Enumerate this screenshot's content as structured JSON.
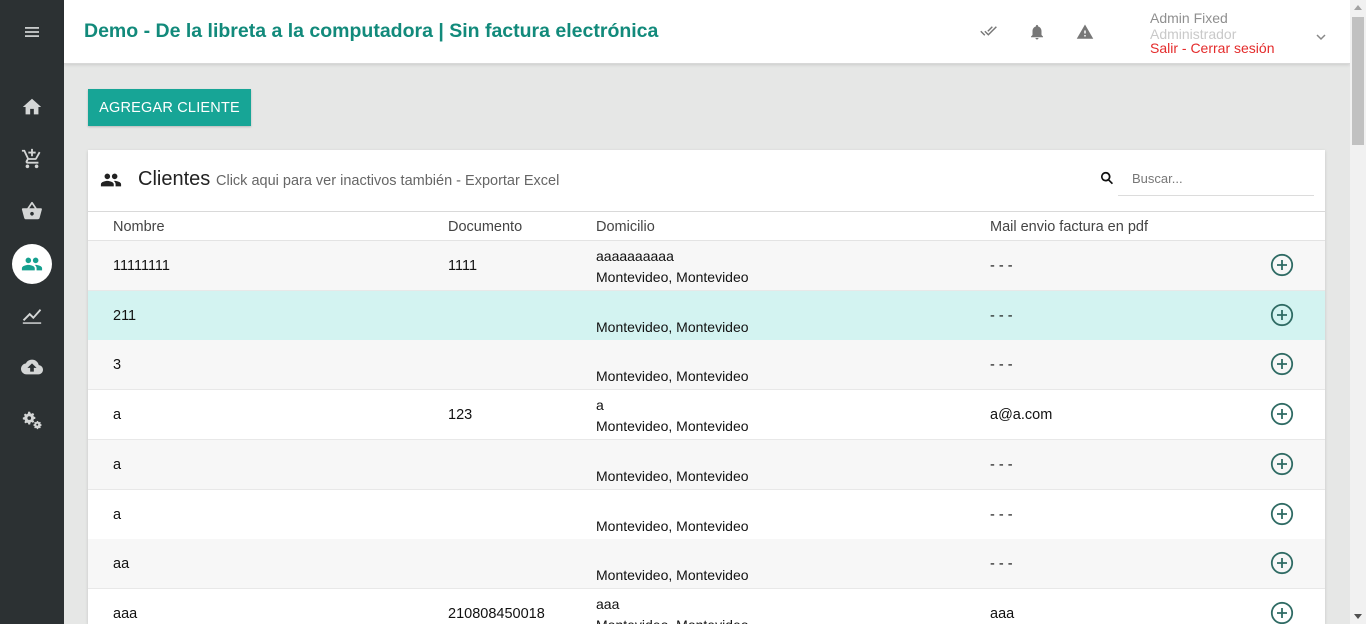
{
  "header": {
    "title": "Demo - De la libreta a la computadora | Sin factura electrónica",
    "user_name": "Admin Fixed",
    "user_role": "Administrador",
    "logout": "Salir - Cerrar sesión"
  },
  "sidebar": {
    "items": [
      "menu-icon",
      "home-icon",
      "cart-icon",
      "basket-icon",
      "clients-icon",
      "chart-icon",
      "upload-icon",
      "settings-icon"
    ],
    "active": "clients-icon"
  },
  "actions": {
    "add_client": "AGREGAR CLIENTE"
  },
  "panel": {
    "title": "Clientes",
    "subtitle": "Click aqui para ver inactivos también - Exportar Excel",
    "search_placeholder": "Buscar..."
  },
  "table": {
    "columns": [
      "Nombre",
      "Documento",
      "Domicilio",
      "Mail envio factura en pdf"
    ],
    "rows": [
      {
        "name": "11111111",
        "doc": "1111",
        "addr1": "aaaaaaaaaa",
        "addr2": "Montevideo, Montevideo",
        "mail": "- - -"
      },
      {
        "name": "211",
        "doc": "",
        "addr1": "",
        "addr2": "Montevideo, Montevideo",
        "mail": "- - -"
      },
      {
        "name": "3",
        "doc": "",
        "addr1": "",
        "addr2": "Montevideo, Montevideo",
        "mail": "- - -"
      },
      {
        "name": "a",
        "doc": "123",
        "addr1": "a",
        "addr2": "Montevideo, Montevideo",
        "mail": "a@a.com"
      },
      {
        "name": "a",
        "doc": "",
        "addr1": "",
        "addr2": "Montevideo, Montevideo",
        "mail": "- - -"
      },
      {
        "name": "a",
        "doc": "",
        "addr1": "",
        "addr2": "Montevideo, Montevideo",
        "mail": "- - -"
      },
      {
        "name": "aa",
        "doc": "",
        "addr1": "",
        "addr2": "Montevideo, Montevideo",
        "mail": "- - -"
      },
      {
        "name": "aaa",
        "doc": "210808450018",
        "addr1": "aaa",
        "addr2": "Montevideo, Montevideo",
        "mail": "aaa"
      }
    ],
    "highlighted_row": 1
  },
  "colors": {
    "accent": "#17a596",
    "title": "#128a7b",
    "sidebar": "#2c3133",
    "highlight": "#d3f3f1",
    "logout": "#e42b2b"
  }
}
